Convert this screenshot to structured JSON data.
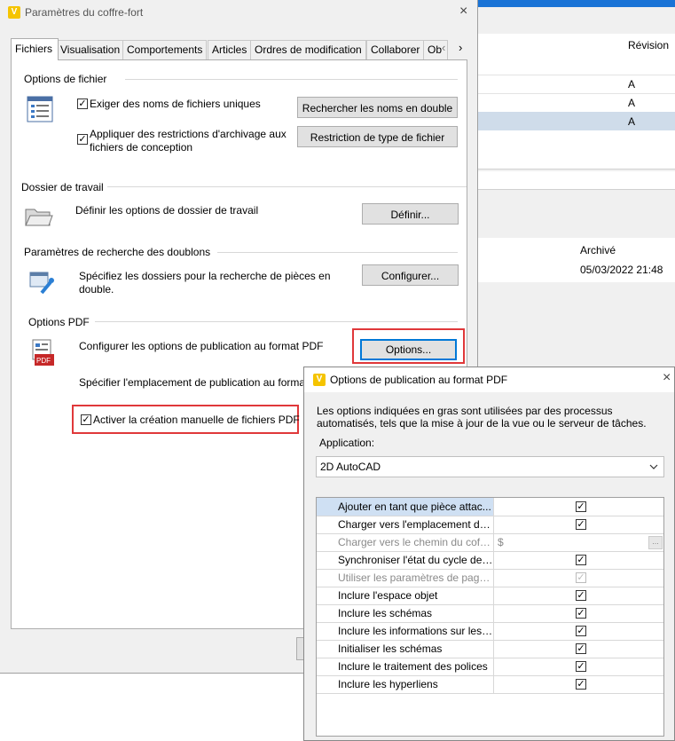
{
  "dialog": {
    "title": "Paramètres du coffre-fort",
    "close": "×",
    "tabs": [
      "Fichiers",
      "Visualisation",
      "Comportements",
      "Articles",
      "Ordres de modification",
      "Collaborer",
      "Ob"
    ],
    "tab_scroll": {
      "left": "‹",
      "right": "›"
    },
    "file_options": {
      "heading": "Options de fichier",
      "unique_names": "Exiger des noms de fichiers uniques",
      "restrictions_line1": "Appliquer des restrictions d'archivage aux",
      "restrictions_line2": "fichiers de conception",
      "find_duplicates_button": "Rechercher les noms en double",
      "file_type_button": "Restriction de type de fichier"
    },
    "working_folder": {
      "heading": "Dossier de travail",
      "text": "Définir les options de dossier de travail",
      "button": "Définir..."
    },
    "duplicates": {
      "heading": "Paramètres de recherche des doublons",
      "text_line1": "Spécifiez les dossiers pour la recherche de pièces en",
      "text_line2": "double.",
      "button": "Configurer..."
    },
    "pdf": {
      "heading": "Options PDF",
      "configure_text": "Configurer les options de publication au format PDF",
      "options_button": "Options...",
      "location_text": "Spécifier l'emplacement de publication au forma",
      "manual_checkbox": "Activer la création manuelle de fichiers PDF"
    }
  },
  "background": {
    "col_revision": "Révision",
    "revisions": [
      "A",
      "A",
      "A"
    ],
    "col_archived": "Archivé",
    "archived_date": "05/03/2022 21:48"
  },
  "pdf_popup": {
    "title": "Options de publication au format PDF",
    "close": "×",
    "description_line1": "Les options indiquées en gras sont utilisées par des processus",
    "description_line2": "automatisés, tels que la mise à jour de la vue ou le serveur de tâches.",
    "application_label": "Application:",
    "application_value": "2D AutoCAD",
    "rows": [
      {
        "name": "Ajouter en tant que pièce attac...",
        "value": "check",
        "enabled": true,
        "selected": true
      },
      {
        "name": "Charger vers l'emplacement du...",
        "value": "check",
        "enabled": true
      },
      {
        "name": "Charger vers le chemin du coffr...",
        "value": "$",
        "enabled": false
      },
      {
        "name": "Synchroniser l'état du cycle de ...",
        "value": "check",
        "enabled": true
      },
      {
        "name": "Utiliser les paramètres de page ...",
        "value": "check",
        "enabled": false
      },
      {
        "name": "Inclure l'espace objet",
        "value": "check",
        "enabled": true
      },
      {
        "name": "Inclure les schémas",
        "value": "check",
        "enabled": true
      },
      {
        "name": "Inclure les informations sur les ...",
        "value": "check",
        "enabled": true
      },
      {
        "name": "Initialiser les schémas",
        "value": "check",
        "enabled": true
      },
      {
        "name": "Inclure le traitement des polices",
        "value": "check",
        "enabled": true
      },
      {
        "name": "Inclure les hyperliens",
        "value": "check",
        "enabled": true
      }
    ]
  },
  "colors": {
    "accent": "#0078d7",
    "highlight": "#e0383a",
    "selected_row": "#cfe0f3",
    "brand": "#f5c400"
  }
}
